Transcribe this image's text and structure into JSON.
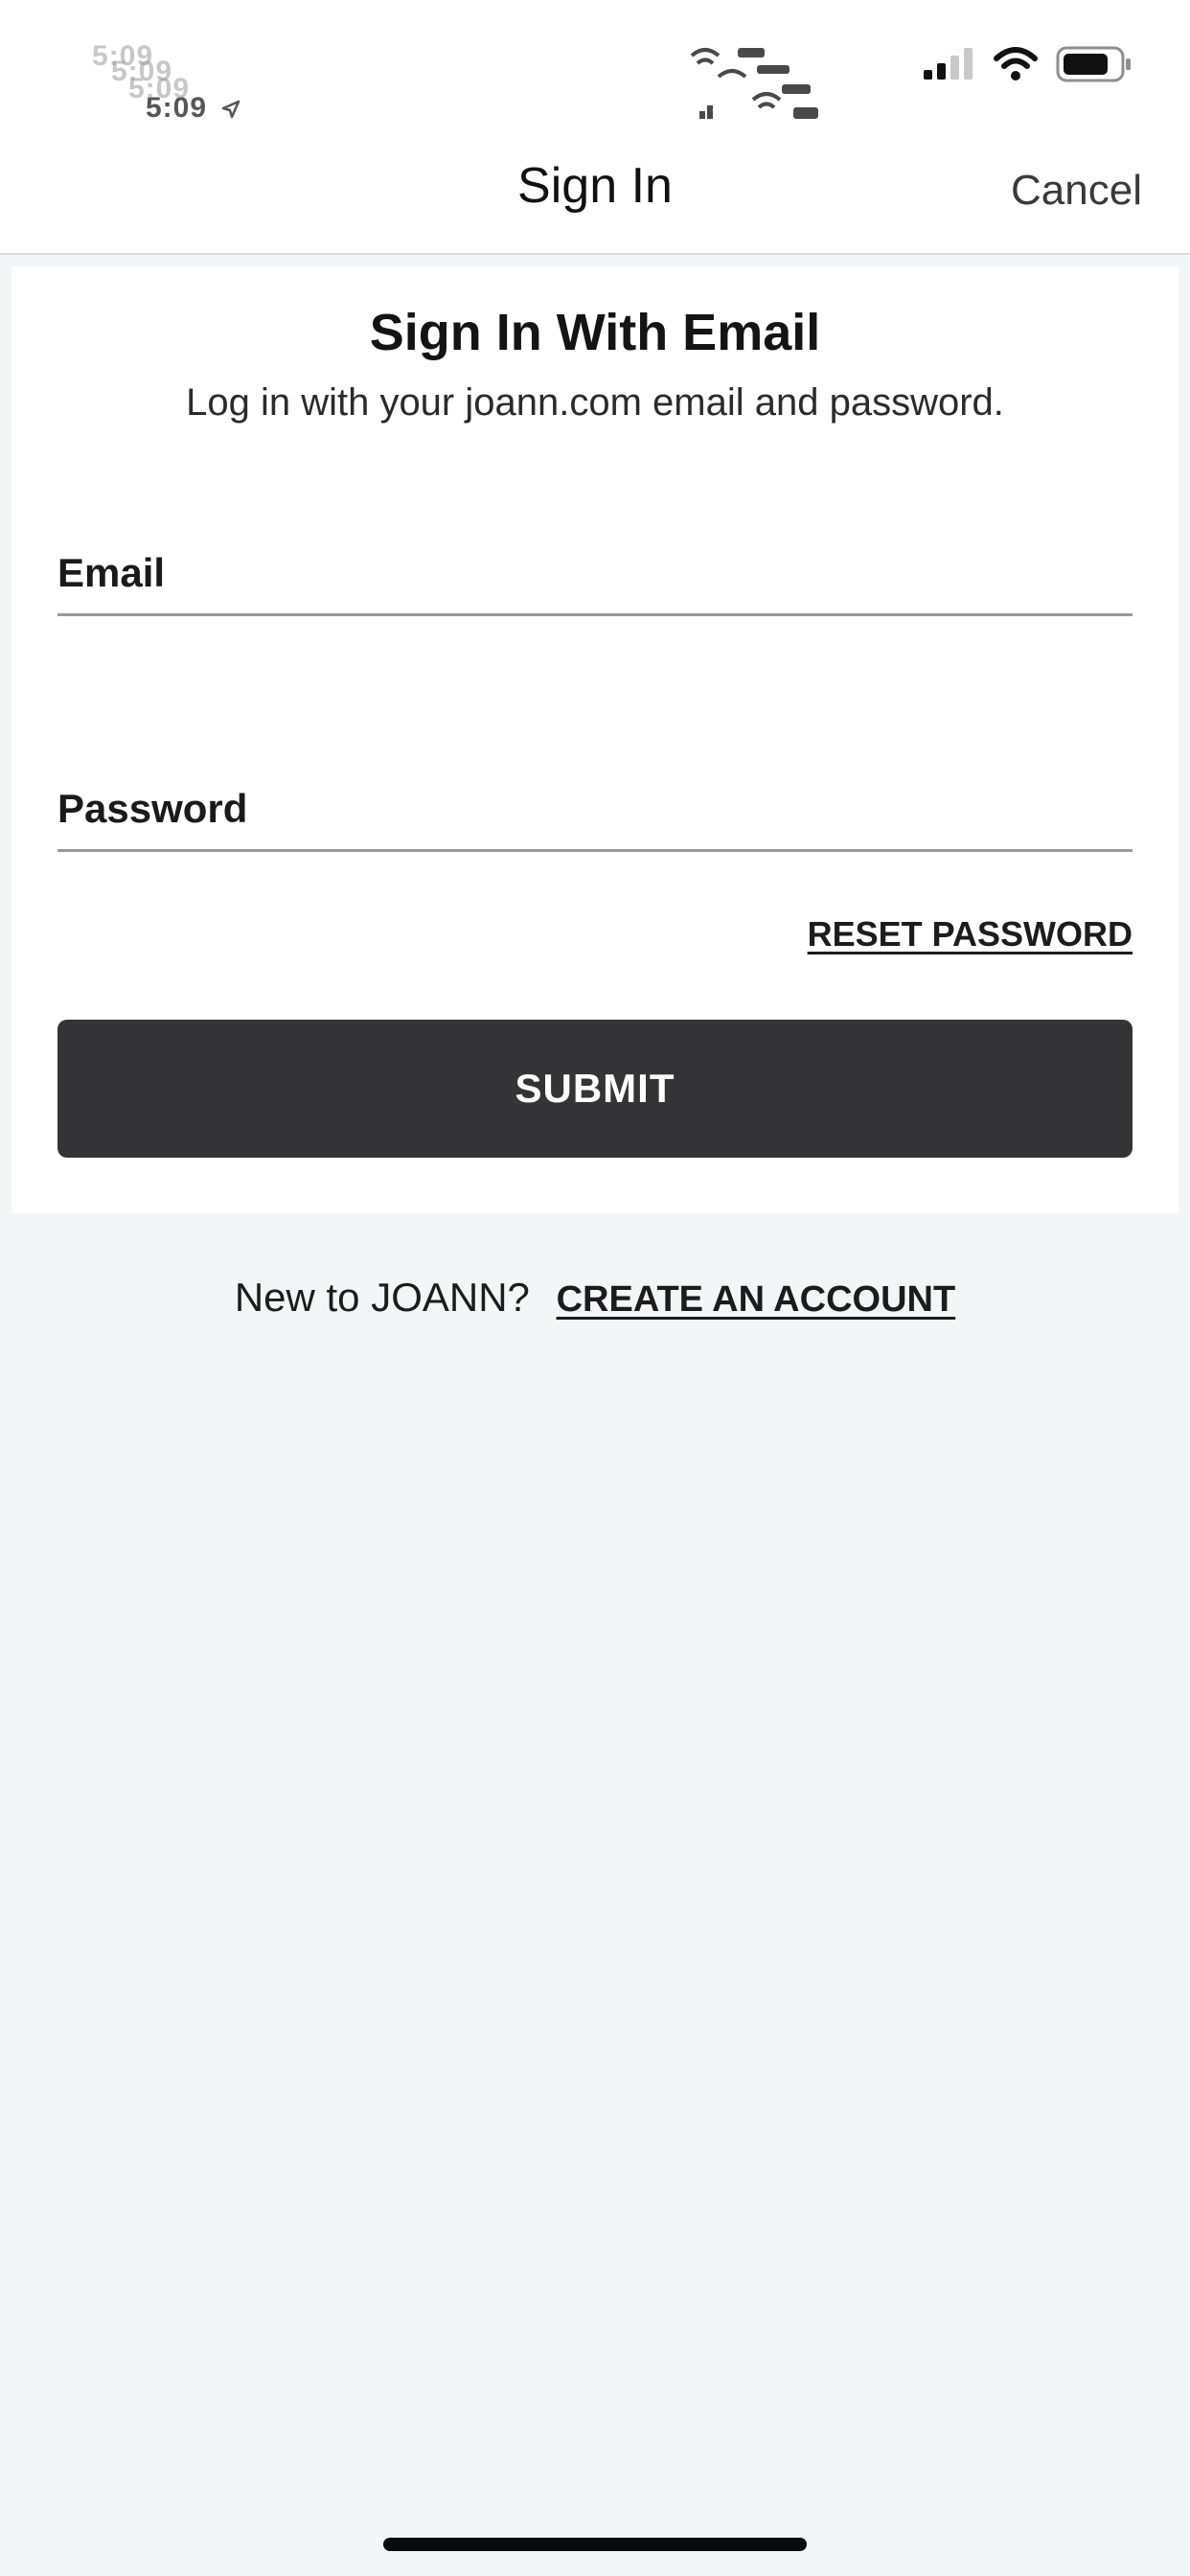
{
  "status_bar": {
    "time": "5:09",
    "icons": [
      "location-arrow-icon",
      "cellular-signal-icon",
      "wifi-icon",
      "battery-icon"
    ]
  },
  "nav": {
    "title": "Sign In",
    "cancel_label": "Cancel"
  },
  "card": {
    "title": "Sign In With Email",
    "subtitle": "Log in with your joann.com email and password.",
    "email_label": "Email",
    "password_label": "Password",
    "reset_label": "RESET PASSWORD",
    "submit_label": "SUBMIT"
  },
  "signup": {
    "prompt": "New to JOANN?",
    "link_label": "CREATE AN ACCOUNT"
  },
  "colors": {
    "background": "#f4f5f7",
    "card": "#ffffff",
    "button": "#343436",
    "text": "#1c1c1e"
  }
}
